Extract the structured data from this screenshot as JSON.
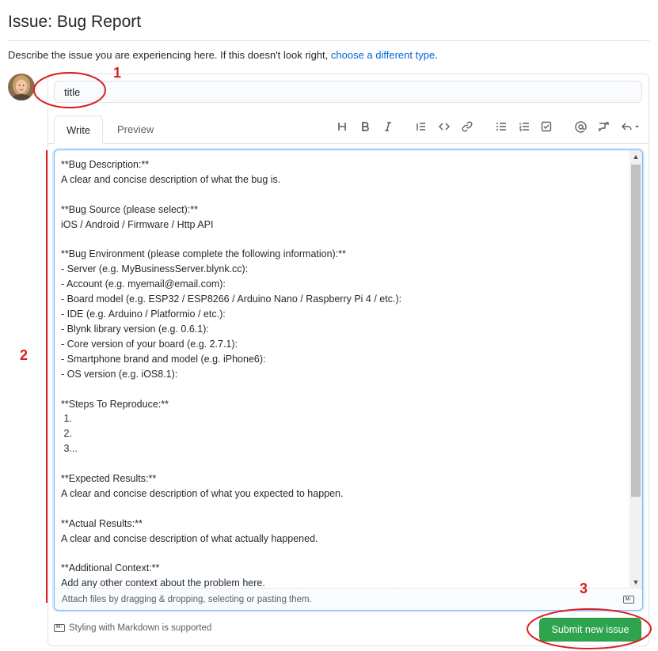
{
  "header": {
    "title": "Issue: Bug Report",
    "describe_text": "Describe the issue you are experiencing here. If this doesn't look right, ",
    "describe_link": "choose a different type",
    "describe_end": "."
  },
  "form": {
    "title_value": "title",
    "tabs": {
      "write": "Write",
      "preview": "Preview"
    },
    "toolbar": [
      "heading-icon",
      "bold-icon",
      "italic-icon",
      "quote-icon",
      "code-icon",
      "link-icon",
      "unordered-list-icon",
      "ordered-list-icon",
      "task-list-icon",
      "mention-icon",
      "cross-reference-icon",
      "reply-icon"
    ],
    "body_text": "**Bug Description:**\nA clear and concise description of what the bug is.\n\n**Bug Source (please select):**\niOS / Android / Firmware / Http API\n\n**Bug Environment (please complete the following information):**\n- Server (e.g. MyBusinessServer.blynk.cc):\n- Account (e.g. myemail@email.com):\n- Board model (e.g. ESP32 / ESP8266 / Arduino Nano / Raspberry Pi 4 / etc.):\n- IDE (e.g. Arduino / Platformio / etc.):\n- Blynk library version (e.g. 0.6.1):\n- Core version of your board (e.g. 2.7.1):\n- Smartphone brand and model (e.g. iPhone6):\n- OS version (e.g. iOS8.1):\n\n**Steps To Reproduce:**\n 1.\n 2.\n 3...\n\n**Expected Results:**\nA clear and concise description of what you expected to happen.\n\n**Actual Results:**\nA clear and concise description of what actually happened.\n\n**Additional Context:**\nAdd any other context about the problem here.",
    "attach_hint": "Attach files by dragging & dropping, selecting or pasting them.",
    "markdown_note": "Styling with Markdown is supported",
    "submit_label": "Submit new issue"
  },
  "annotations": {
    "one": "1",
    "two": "2",
    "three": "3"
  },
  "colors": {
    "accent_link": "#0366d6",
    "submit_green": "#2ea44f",
    "annotation_red": "#dc1f1f"
  }
}
